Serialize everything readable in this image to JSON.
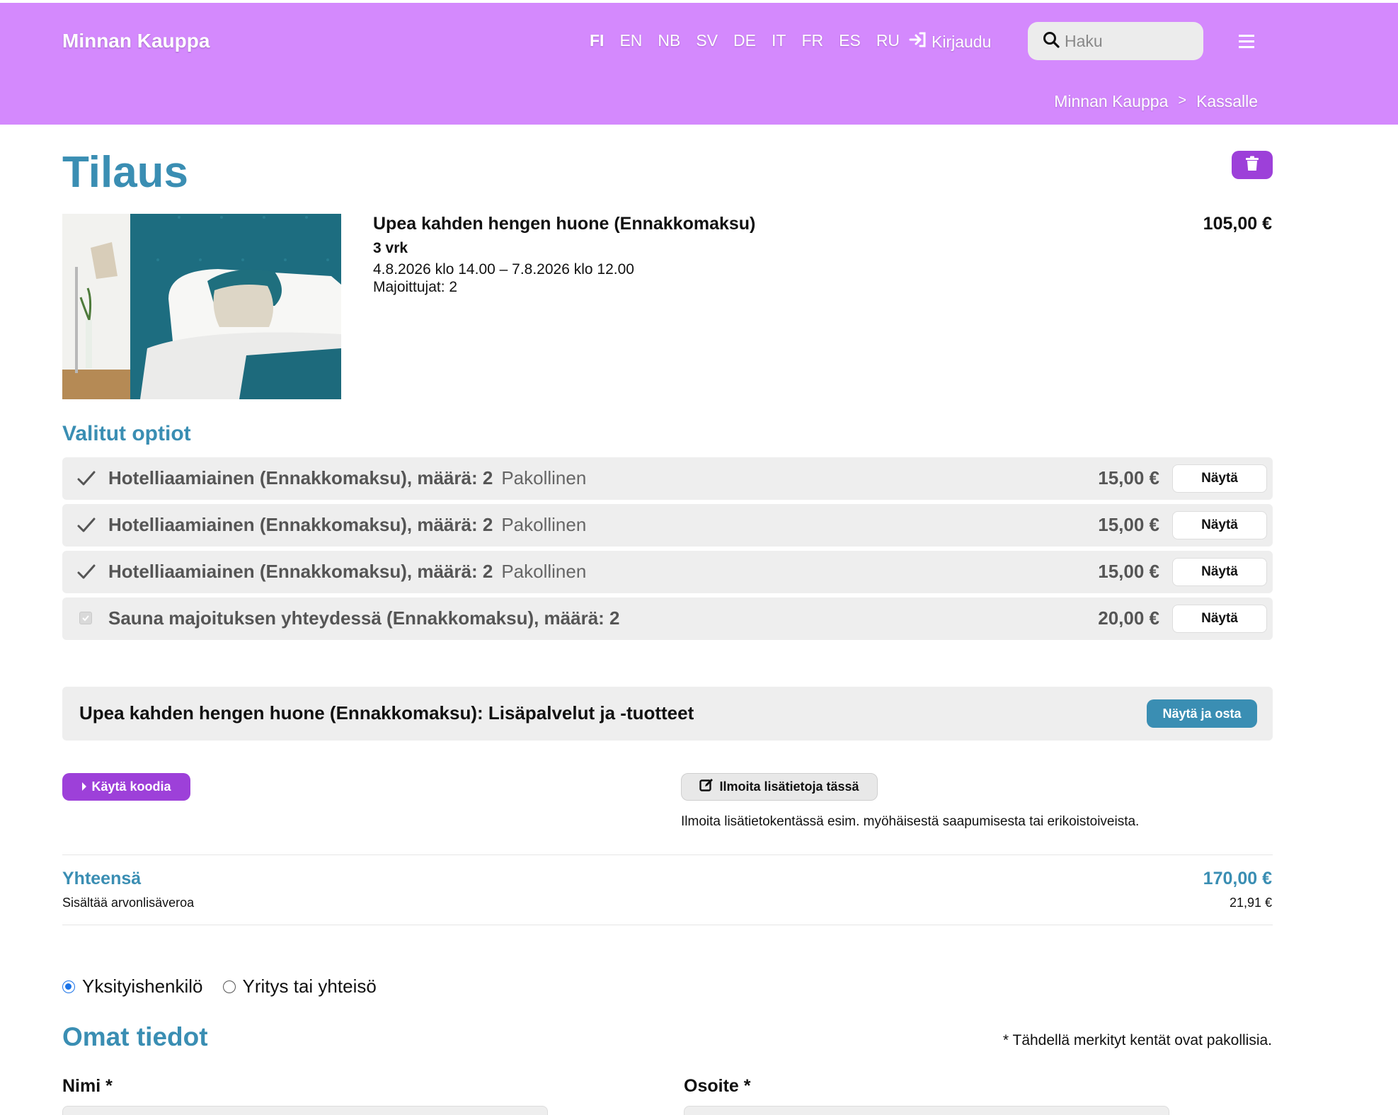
{
  "header": {
    "brand": "Minnan Kauppa",
    "languages": [
      "FI",
      "EN",
      "NB",
      "SV",
      "DE",
      "IT",
      "FR",
      "ES",
      "RU"
    ],
    "active_language": "FI",
    "login_label": "Kirjaudu",
    "search_placeholder": "Haku",
    "breadcrumb": [
      "Minnan Kauppa",
      "Kassalle"
    ],
    "breadcrumb_separator": ">",
    "accent_color": "#d489fd"
  },
  "order": {
    "title": "Tilaus",
    "product": {
      "name": "Upea kahden hengen huone (Ennakkomaksu)",
      "nights": "3 vrk",
      "dates": "4.8.2026 klo 14.00 – 7.8.2026 klo 12.00",
      "guests": "Majoittujat: 2",
      "price": "105,00 €"
    }
  },
  "options": {
    "title": "Valitut optiot",
    "items": [
      {
        "label": "Hotelliaamiainen (Ennakkomaksu), määrä: 2",
        "tag": "Pakollinen",
        "price": "15,00 €",
        "button": "Näytä",
        "indicator": "check"
      },
      {
        "label": "Hotelliaamiainen (Ennakkomaksu), määrä: 2",
        "tag": "Pakollinen",
        "price": "15,00 €",
        "button": "Näytä",
        "indicator": "check"
      },
      {
        "label": "Hotelliaamiainen (Ennakkomaksu), määrä: 2",
        "tag": "Pakollinen",
        "price": "15,00 €",
        "button": "Näytä",
        "indicator": "check"
      },
      {
        "label": "Sauna majoituksen yhteydessä (Ennakkomaksu), määrä: 2",
        "tag": "",
        "price": "20,00 €",
        "button": "Näytä",
        "indicator": "checkbox"
      }
    ]
  },
  "extras": {
    "title": "Upea kahden hengen huone (Ennakkomaksu): Lisäpalvelut ja -tuotteet",
    "button": "Näytä ja osta"
  },
  "actions": {
    "code_button": "Käytä koodia",
    "info_button": "Ilmoita lisätietoja tässä",
    "info_note": "Ilmoita lisätietokentässä esim. myöhäisestä saapumisesta tai erikoistoiveista."
  },
  "totals": {
    "total_label": "Yhteensä",
    "total_value": "170,00 €",
    "vat_label": "Sisältää arvonlisäveroa",
    "vat_value": "21,91 €"
  },
  "customer_type": {
    "options": [
      "Yksityishenkilö",
      "Yritys tai yhteisö"
    ],
    "selected": "Yksityishenkilö"
  },
  "form": {
    "title": "Omat tiedot",
    "required_note": "* Tähdellä merkityt kentät ovat pakollisia.",
    "name_label": "Nimi *",
    "address_label": "Osoite *"
  },
  "colors": {
    "heading_blue": "#3a8eb3",
    "purple_button": "#9d40d9",
    "panel_gray": "#eeeeee"
  }
}
